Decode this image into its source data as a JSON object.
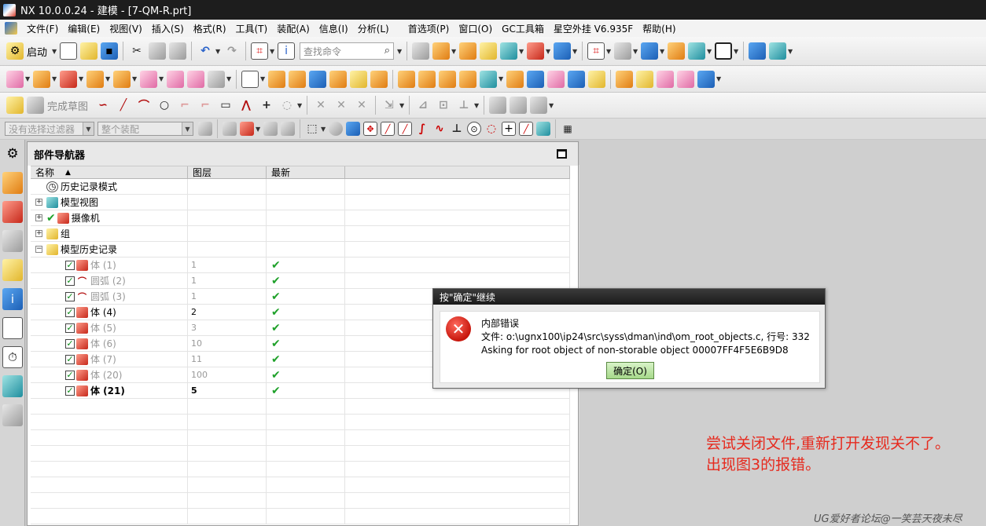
{
  "window": {
    "title": "NX 10.0.0.24 - 建模 - [7-QM-R.prt]"
  },
  "menu": {
    "items": [
      "文件(F)",
      "编辑(E)",
      "视图(V)",
      "插入(S)",
      "格式(R)",
      "工具(T)",
      "装配(A)",
      "信息(I)",
      "分析(L)"
    ],
    "right_items": [
      "首选项(P)",
      "窗口(O)",
      "GC工具箱",
      "星空外挂 V6.935F",
      "帮助(H)"
    ]
  },
  "toolbar": {
    "start_label": "启动",
    "search_placeholder": "查找命令",
    "finish_sketch_label": "完成草图"
  },
  "selection_bar": {
    "filter_value": "没有选择过滤器",
    "scope_value": "整个装配"
  },
  "navigator": {
    "title": "部件导航器",
    "columns": {
      "name": "名称",
      "layer": "图层",
      "latest": "最新"
    },
    "tree": [
      {
        "label": "历史记录模式",
        "layer": "",
        "latest": "",
        "expander": "",
        "icon": "clock-icon"
      },
      {
        "label": "模型视图",
        "layer": "",
        "latest": "",
        "expander": "+",
        "icon": "model-view-icon"
      },
      {
        "label": "摄像机",
        "layer": "",
        "latest": "",
        "expander": "+",
        "icon": "camera-icon"
      },
      {
        "label": "组",
        "layer": "",
        "latest": "",
        "expander": "+",
        "icon": "folder-icon"
      },
      {
        "label": "模型历史记录",
        "layer": "",
        "latest": "",
        "expander": "−",
        "icon": "folder-open-icon"
      }
    ],
    "history": [
      {
        "label": "体 (1)",
        "layer": "1",
        "latest": "✔",
        "style": "dim",
        "icon": "body-icon"
      },
      {
        "label": "圆弧 (2)",
        "layer": "1",
        "latest": "✔",
        "style": "dim",
        "icon": "arc-icon"
      },
      {
        "label": "圆弧 (3)",
        "layer": "1",
        "latest": "✔",
        "style": "dim",
        "icon": "arc-icon"
      },
      {
        "label": "体 (4)",
        "layer": "2",
        "latest": "✔",
        "style": "act",
        "icon": "body-icon"
      },
      {
        "label": "体 (5)",
        "layer": "3",
        "latest": "✔",
        "style": "dim",
        "icon": "body-icon"
      },
      {
        "label": "体 (6)",
        "layer": "10",
        "latest": "✔",
        "style": "dim",
        "icon": "body-icon"
      },
      {
        "label": "体 (7)",
        "layer": "11",
        "latest": "✔",
        "style": "dim",
        "icon": "body-icon"
      },
      {
        "label": "体 (20)",
        "layer": "100",
        "latest": "✔",
        "style": "dim",
        "icon": "body-icon"
      },
      {
        "label": "体 (21)",
        "layer": "5",
        "latest": "✔",
        "style": "bold",
        "icon": "body-icon"
      }
    ]
  },
  "dialog": {
    "title": "按\"确定\"继续",
    "heading": "内部错误",
    "line1": "文件: o:\\ugnx100\\ip24\\src\\syss\\dman\\ind\\om_root_objects.c, 行号: 332",
    "line2": "Asking for root object of non-storable object 00007FF4F5E6B9D8",
    "ok_label": "确定(O)"
  },
  "annotation": {
    "line1": "尝试关闭文件,重新打开发现关不了。",
    "line2": "出现图3的报错。"
  },
  "watermark": "UG爱好者论坛@一笑芸天夜未尽"
}
